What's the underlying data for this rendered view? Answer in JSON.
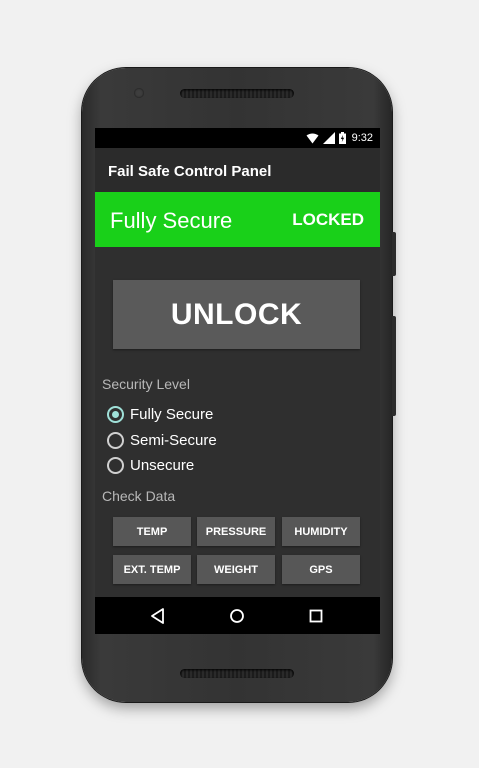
{
  "status_bar": {
    "time": "9:32"
  },
  "app_bar": {
    "title": "Fail Safe Control Panel"
  },
  "banner": {
    "status": "Fully Secure",
    "lock_state": "LOCKED",
    "color": "#19d019"
  },
  "unlock_button": {
    "label": "UNLOCK"
  },
  "security_level": {
    "label": "Security Level",
    "options": [
      "Fully Secure",
      "Semi-Secure",
      "Unsecure"
    ],
    "selected": "Fully Secure"
  },
  "check_data": {
    "label": "Check Data",
    "buttons": [
      "TEMP",
      "PRESSURE",
      "HUMIDITY",
      "EXT. TEMP",
      "WEIGHT",
      "GPS"
    ]
  },
  "nav": {
    "icons": [
      "back-icon",
      "home-icon",
      "recents-icon"
    ]
  },
  "colors": {
    "accent_radio": "#9fe0d8",
    "button_gray": "#575757"
  }
}
